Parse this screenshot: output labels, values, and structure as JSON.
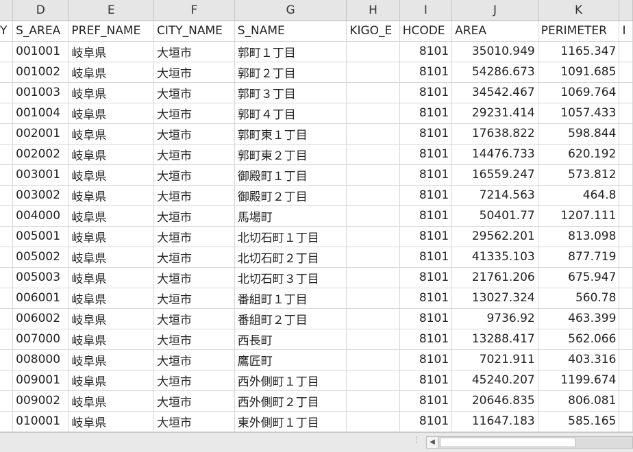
{
  "columns": [
    {
      "letter": "",
      "header": "Y"
    },
    {
      "letter": "D",
      "header": "S_AREA"
    },
    {
      "letter": "E",
      "header": "PREF_NAME"
    },
    {
      "letter": "F",
      "header": "CITY_NAME"
    },
    {
      "letter": "G",
      "header": "S_NAME"
    },
    {
      "letter": "H",
      "header": "KIGO_E"
    },
    {
      "letter": "I",
      "header": "HCODE"
    },
    {
      "letter": "J",
      "header": "AREA"
    },
    {
      "letter": "K",
      "header": "PERIMETER"
    },
    {
      "letter": "",
      "header": "I"
    }
  ],
  "rows": [
    [
      "001001",
      "岐阜県",
      "大垣市",
      "郭町１丁目",
      "",
      "8101",
      "35010.949",
      "1165.347"
    ],
    [
      "001002",
      "岐阜県",
      "大垣市",
      "郭町２丁目",
      "",
      "8101",
      "54286.673",
      "1091.685"
    ],
    [
      "001003",
      "岐阜県",
      "大垣市",
      "郭町３丁目",
      "",
      "8101",
      "34542.467",
      "1069.764"
    ],
    [
      "001004",
      "岐阜県",
      "大垣市",
      "郭町４丁目",
      "",
      "8101",
      "29231.414",
      "1057.433"
    ],
    [
      "002001",
      "岐阜県",
      "大垣市",
      "郭町東１丁目",
      "",
      "8101",
      "17638.822",
      "598.844"
    ],
    [
      "002002",
      "岐阜県",
      "大垣市",
      "郭町東２丁目",
      "",
      "8101",
      "14476.733",
      "620.192"
    ],
    [
      "003001",
      "岐阜県",
      "大垣市",
      "御殿町１丁目",
      "",
      "8101",
      "16559.247",
      "573.812"
    ],
    [
      "003002",
      "岐阜県",
      "大垣市",
      "御殿町２丁目",
      "",
      "8101",
      "7214.563",
      "464.8"
    ],
    [
      "004000",
      "岐阜県",
      "大垣市",
      "馬場町",
      "",
      "8101",
      "50401.77",
      "1207.111"
    ],
    [
      "005001",
      "岐阜県",
      "大垣市",
      "北切石町１丁目",
      "",
      "8101",
      "29562.201",
      "813.098"
    ],
    [
      "005002",
      "岐阜県",
      "大垣市",
      "北切石町２丁目",
      "",
      "8101",
      "41335.103",
      "877.719"
    ],
    [
      "005003",
      "岐阜県",
      "大垣市",
      "北切石町３丁目",
      "",
      "8101",
      "21761.206",
      "675.947"
    ],
    [
      "006001",
      "岐阜県",
      "大垣市",
      "番組町１丁目",
      "",
      "8101",
      "13027.324",
      "560.78"
    ],
    [
      "006002",
      "岐阜県",
      "大垣市",
      "番組町２丁目",
      "",
      "8101",
      "9736.92",
      "463.399"
    ],
    [
      "007000",
      "岐阜県",
      "大垣市",
      "西長町",
      "",
      "8101",
      "13288.417",
      "562.066"
    ],
    [
      "008000",
      "岐阜県",
      "大垣市",
      "鷹匠町",
      "",
      "8101",
      "7021.911",
      "403.316"
    ],
    [
      "009001",
      "岐阜県",
      "大垣市",
      "西外側町１丁目",
      "",
      "8101",
      "45240.207",
      "1199.674"
    ],
    [
      "009002",
      "岐阜県",
      "大垣市",
      "西外側町２丁目",
      "",
      "8101",
      "20646.835",
      "806.081"
    ],
    [
      "010001",
      "岐阜県",
      "大垣市",
      "東外側町１丁目",
      "",
      "8101",
      "11647.183",
      "585.165"
    ]
  ],
  "scrollbar": {
    "left_arrow": "◀"
  }
}
